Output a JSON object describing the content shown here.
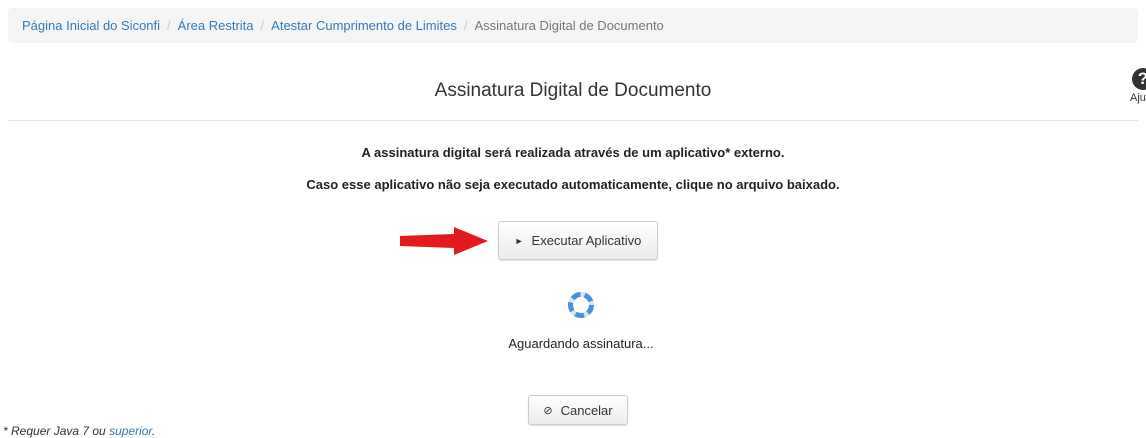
{
  "breadcrumb": {
    "items": [
      {
        "label": "Página Inicial do Siconfi"
      },
      {
        "label": "Área Restrita"
      },
      {
        "label": "Atestar Cumprimento de Limites"
      }
    ],
    "separator": "/",
    "current": "Assinatura Digital de Documento"
  },
  "page": {
    "title": "Assinatura Digital de Documento"
  },
  "help": {
    "icon": "question-circle-icon",
    "glyph": "?",
    "label": "Ajuda"
  },
  "messages": {
    "line1": "A assinatura digital será realizada através de um aplicativo* externo.",
    "line2": "Caso esse aplicativo não seja executado automaticamente, clique no arquivo baixado."
  },
  "execute_button": {
    "icon": "play-icon",
    "glyph": "►",
    "label": "Executar Aplicativo"
  },
  "status": {
    "icon": "loading-spinner-icon",
    "text": "Aguardando assinatura..."
  },
  "cancel_button": {
    "icon": "ban-icon",
    "glyph": "⊘",
    "label": "Cancelar"
  },
  "footnote": {
    "text": "* Requer Java 7 ou ",
    "link": "superior",
    "suffix": "."
  },
  "colors": {
    "link": "#337ab7",
    "arrow": "#e4191b",
    "spinner": "#4a90d9",
    "breadcrumb_bg": "#f5f5f5"
  }
}
